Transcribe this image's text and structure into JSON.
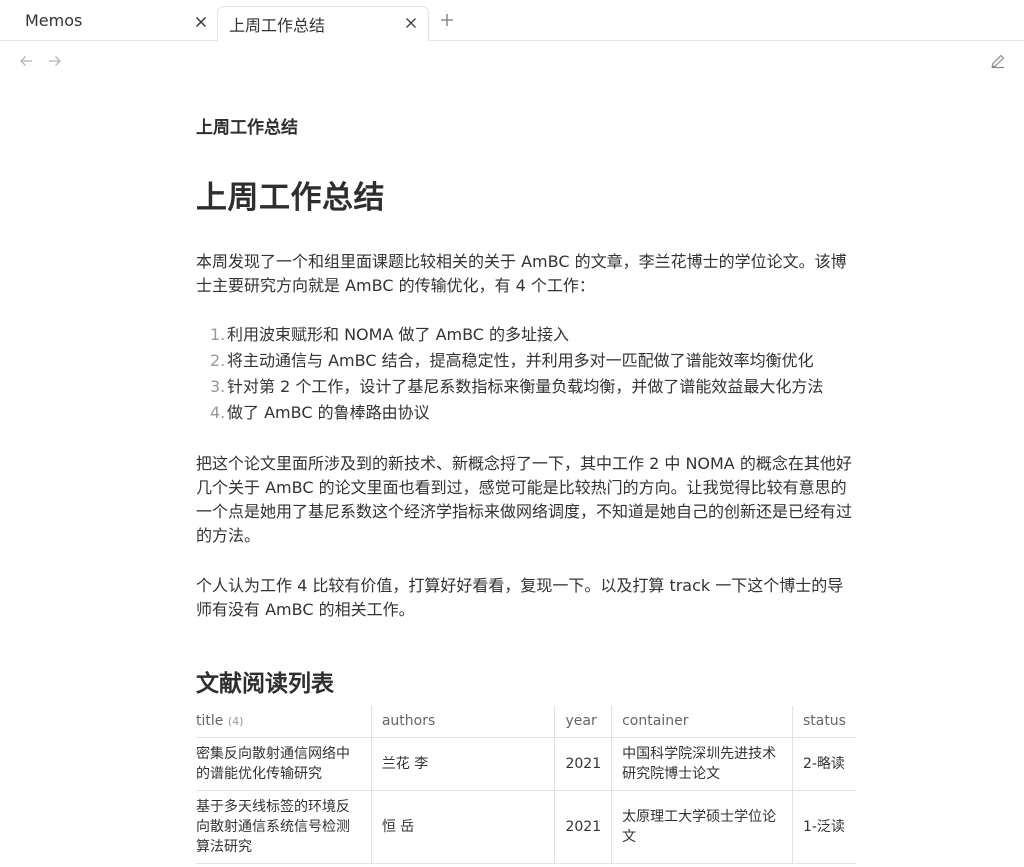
{
  "tabs": [
    {
      "label": "Memos"
    },
    {
      "label": "上周工作总结"
    }
  ],
  "note": {
    "inline_title": "上周工作总结",
    "heading": "上周工作总结",
    "intro": "本周发现了一个和组里面课题比较相关的关于 AmBC 的文章，李兰花博士的学位论文。该博士主要研究方向就是 AmBC 的传输优化，有 4 个工作：",
    "list": [
      {
        "num": "1.",
        "text": "利用波束赋形和 NOMA 做了 AmBC 的多址接入"
      },
      {
        "num": "2.",
        "text": "将主动通信与 AmBC 结合，提高稳定性，并利用多对一匹配做了谱能效率均衡优化"
      },
      {
        "num": "3.",
        "text": "针对第 2 个工作，设计了基尼系数指标来衡量负载均衡，并做了谱能效益最大化方法"
      },
      {
        "num": "4.",
        "text": "做了 AmBC 的鲁棒路由协议"
      }
    ],
    "para2": "把这个论文里面所涉及到的新技术、新概念捋了一下，其中工作 2 中 NOMA 的概念在其他好几个关于 AmBC 的论文里面也看到过，感觉可能是比较热门的方向。让我觉得比较有意思的一个点是她用了基尼系数这个经济学指标来做网络调度，不知道是她自己的创新还是已经有过的方法。",
    "para3": "个人认为工作 4 比较有价值，打算好好看看，复现一下。以及打算 track 一下这个博士的导师有没有 AmBC 的相关工作。",
    "section_heading": "文献阅读列表"
  },
  "table": {
    "headers": {
      "title": "title",
      "title_count": "(4)",
      "authors": "authors",
      "year": "year",
      "container": "container",
      "status": "status"
    },
    "rows": [
      {
        "title": "密集反向散射通信网络中的谱能优化传输研究",
        "authors": "兰花 李",
        "year": "2021",
        "container": "中国科学院深圳先进技术研究院博士论文",
        "status": "2-略读"
      },
      {
        "title": "基于多天线标签的环境反向散射通信系统信号检测算法研究",
        "authors": "恒 岳",
        "year": "2021",
        "container": "太原理工大学硕士学位论文",
        "status": "1-泛读"
      }
    ]
  }
}
